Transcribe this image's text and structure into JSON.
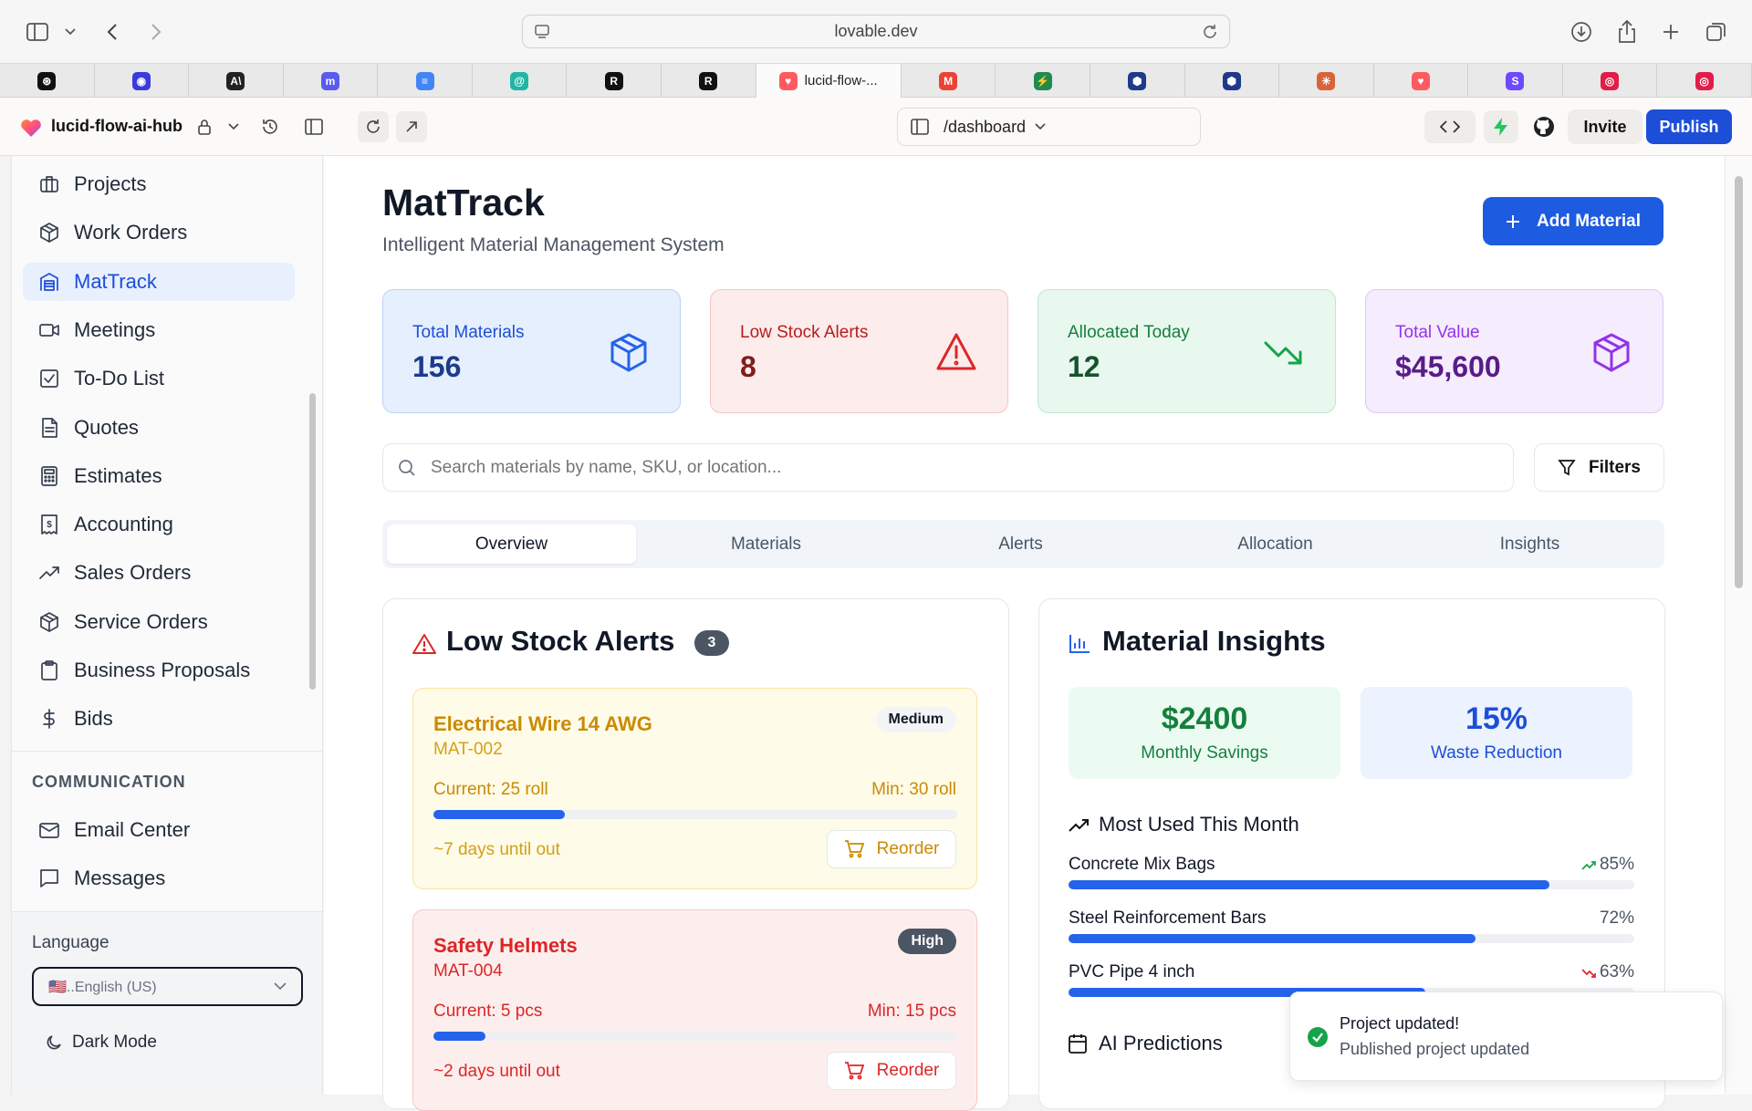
{
  "browser": {
    "url": "lovable.dev",
    "active_tab_title": "lucid-flow-...",
    "tabs": [
      {
        "icon": "openai-icon",
        "color": "#111111",
        "glyph": "⊛"
      },
      {
        "icon": "blue-circle-icon",
        "color": "#3b3bdb",
        "glyph": "◉"
      },
      {
        "icon": "anthropic-icon",
        "color": "#222222",
        "glyph": "A\\"
      },
      {
        "icon": "m-logo-icon",
        "color": "#5b5bf0",
        "glyph": "m"
      },
      {
        "icon": "docs-icon",
        "color": "#4285f4",
        "glyph": "≡"
      },
      {
        "icon": "spiral-icon",
        "color": "#22b5a5",
        "glyph": "@"
      },
      {
        "icon": "r-logo-icon",
        "color": "#111111",
        "glyph": "R"
      },
      {
        "icon": "r-logo-icon",
        "color": "#111111",
        "glyph": "R"
      },
      {
        "icon": "lovable-icon",
        "color": "#ff5a5f",
        "glyph": "♥"
      },
      {
        "icon": "gmail-icon",
        "color": "#ea4335",
        "glyph": "M"
      },
      {
        "icon": "bolt-icon",
        "color": "#1f8b4c",
        "glyph": "⚡"
      },
      {
        "icon": "hex-icon",
        "color": "#1e3a8a",
        "glyph": "⬢"
      },
      {
        "icon": "hex-icon",
        "color": "#1e3a8a",
        "glyph": "⬢"
      },
      {
        "icon": "claude-icon",
        "color": "#d9643a",
        "glyph": "✳"
      },
      {
        "icon": "lovable-icon",
        "color": "#ff5a5f",
        "glyph": "♥"
      },
      {
        "icon": "s-logo-icon",
        "color": "#6d4aff",
        "glyph": "S"
      },
      {
        "icon": "red-target-icon",
        "color": "#e11d48",
        "glyph": "◎"
      },
      {
        "icon": "red-target-icon",
        "color": "#e11d48",
        "glyph": "◎"
      }
    ]
  },
  "toolbar": {
    "project_name": "lucid-flow-ai-hub",
    "route": "/dashboard",
    "invite_label": "Invite",
    "publish_label": "Publish"
  },
  "sidebar": {
    "items": [
      {
        "label": "Projects",
        "icon": "briefcase-icon"
      },
      {
        "label": "Work Orders",
        "icon": "package-icon"
      },
      {
        "label": "MatTrack",
        "icon": "warehouse-icon",
        "active": true
      },
      {
        "label": "Meetings",
        "icon": "video-icon"
      },
      {
        "label": "To-Do List",
        "icon": "checkbox-icon"
      },
      {
        "label": "Quotes",
        "icon": "file-text-icon"
      },
      {
        "label": "Estimates",
        "icon": "calculator-icon"
      },
      {
        "label": "Accounting",
        "icon": "receipt-icon"
      },
      {
        "label": "Sales Orders",
        "icon": "trending-up-icon"
      },
      {
        "label": "Service Orders",
        "icon": "package-icon"
      },
      {
        "label": "Business Proposals",
        "icon": "clipboard-icon"
      },
      {
        "label": "Bids",
        "icon": "dollar-icon"
      }
    ],
    "section_communication": "COMMUNICATION",
    "comm_items": [
      {
        "label": "Email Center",
        "icon": "mail-icon"
      },
      {
        "label": "Messages",
        "icon": "message-icon"
      }
    ],
    "language_label": "Language",
    "language_value": "🇺🇸..English (US)",
    "dark_mode_label": "Dark Mode"
  },
  "page": {
    "title": "MatTrack",
    "subtitle": "Intelligent Material Management System",
    "add_material_label": "Add Material",
    "search_placeholder": "Search materials by name, SKU, or location...",
    "filters_label": "Filters"
  },
  "stats": [
    {
      "label": "Total Materials",
      "value": "156",
      "icon": "box-icon",
      "bg": "#e6effd",
      "border": "#bcd2f7",
      "label_color": "#1d4ed8",
      "value_color": "#1e3a8a",
      "icon_color": "#2563eb"
    },
    {
      "label": "Low Stock Alerts",
      "value": "8",
      "icon": "warning-triangle-icon",
      "bg": "#fdecec",
      "border": "#f7c3c3",
      "label_color": "#b91c1c",
      "value_color": "#7f1d1d",
      "icon_color": "#dc2626"
    },
    {
      "label": "Allocated Today",
      "value": "12",
      "icon": "trending-down-icon",
      "bg": "#e8f8ee",
      "border": "#bde8cd",
      "label_color": "#15803d",
      "value_color": "#14532d",
      "icon_color": "#16a34a"
    },
    {
      "label": "Total Value",
      "value": "$45,600",
      "icon": "box-icon",
      "bg": "#f5ecfd",
      "border": "#e0c8f7",
      "label_color": "#9333ea",
      "value_color": "#581c87",
      "icon_color": "#9333ea"
    }
  ],
  "tabs": [
    {
      "label": "Overview",
      "active": true
    },
    {
      "label": "Materials"
    },
    {
      "label": "Alerts"
    },
    {
      "label": "Allocation"
    },
    {
      "label": "Insights"
    }
  ],
  "low_stock": {
    "title": "Low Stock Alerts",
    "count": "3",
    "alerts": [
      {
        "name": "Electrical Wire 14 AWG",
        "sku": "MAT-002",
        "severity": "Medium",
        "current": "Current: 25 roll",
        "min": "Min: 30 roll",
        "fill_fraction": 0.25,
        "days": "~7 days until out",
        "reorder_label": "Reorder",
        "bg": "#fefbe8",
        "border": "#fbe3a0",
        "title_color": "#ca8a04",
        "muted_color": "#d4a017",
        "badge_bg": "#f3f4f6",
        "badge_color": "#111827"
      },
      {
        "name": "Safety Helmets",
        "sku": "MAT-004",
        "severity": "High",
        "current": "Current: 5 pcs",
        "min": "Min: 15 pcs",
        "fill_fraction": 0.1,
        "days": "~2 days until out",
        "reorder_label": "Reorder",
        "bg": "#fdeeee",
        "border": "#f7c5c5",
        "title_color": "#dc2626",
        "muted_color": "#dc2626",
        "badge_bg": "#4b5563",
        "badge_color": "#ffffff"
      }
    ]
  },
  "insights": {
    "title": "Material Insights",
    "savings_value": "$2400",
    "savings_label": "Monthly Savings",
    "waste_value": "15%",
    "waste_label": "Waste Reduction",
    "most_used_title": "Most Used This Month",
    "most_used": [
      {
        "name": "Concrete Mix Bags",
        "percent": "85%",
        "value": 0.85,
        "trend": "up"
      },
      {
        "name": "Steel Reinforcement Bars",
        "percent": "72%",
        "value": 0.72,
        "trend": "none"
      },
      {
        "name": "PVC Pipe 4 inch",
        "percent": "63%",
        "value": 0.63,
        "trend": "down"
      }
    ],
    "ai_predictions_title": "AI Predictions"
  },
  "toast": {
    "title": "Project updated!",
    "description": "Published project updated"
  },
  "colors": {
    "accent": "#2563eb",
    "publish": "#1d4ed8"
  }
}
